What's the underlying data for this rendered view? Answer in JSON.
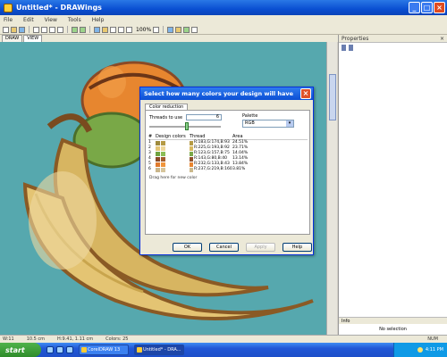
{
  "window": {
    "title": "Untitled* - DRAWings"
  },
  "menu": [
    "File",
    "Edit",
    "View",
    "Tools",
    "Help"
  ],
  "toolbar": {
    "zoom": "100%"
  },
  "tabs": [
    "DRAW",
    "VIEW"
  ],
  "properties": {
    "title": "Properties",
    "info_label": "Info",
    "info_value": "No selection"
  },
  "statusbar": {
    "w": "W:11",
    "h": "10.5 cm",
    "pos": "H:9.41, 1.11 cm",
    "colors": "Colors: 25",
    "right": "NUM"
  },
  "taskbar": {
    "start": "start",
    "tasks": [
      "CorelDRAW 13",
      "Untitled* - DRA..."
    ],
    "clock": "4:11 PM"
  },
  "dialog": {
    "title": "Select how many colors your design will have",
    "tab": "Color reduction",
    "threads_label": "Threads to use",
    "threads_value": "6",
    "palette_label": "Palette",
    "palette_value": "RGB",
    "columns": [
      "#",
      "Design colors",
      "Thread",
      "Area"
    ],
    "rows": [
      {
        "num": "1",
        "design": [
          "#9e8a3c",
          "#b59a44"
        ],
        "thread_color": "#b59a44",
        "thread": "R:183,G:174,B:93",
        "area": "24.51%"
      },
      {
        "num": "2",
        "design": [
          "#e3c473",
          "#efd79a"
        ],
        "thread_color": "#d9b85e",
        "thread": "R:225,G:193,B:92",
        "area": "23.71%"
      },
      {
        "num": "3",
        "design": [
          "#6fa23f",
          "#8bbd57"
        ],
        "thread_color": "#7aa849",
        "thread": "R:123,G:157,B:75",
        "area": "14.04%"
      },
      {
        "num": "4",
        "design": [
          "#8a4a26",
          "#a25c2f"
        ],
        "thread_color": "#8f4f2a",
        "thread": "R:143,G:80,B:40",
        "area": "13.14%"
      },
      {
        "num": "5",
        "design": [
          "#e07a2c",
          "#f0953c"
        ],
        "thread_color": "#e8852f",
        "thread": "R:232,G:133,B:43",
        "area": "13.84%"
      },
      {
        "num": "6",
        "design": [
          "#c9b58a",
          "#d6c59c"
        ],
        "thread_color": "#cbb98c",
        "thread": "R:237,G:219,B:160",
        "area": "3.81%"
      }
    ],
    "hint": "Drag here for new color",
    "buttons": {
      "ok": "OK",
      "cancel": "Cancel",
      "apply": "Apply",
      "help": "Help"
    }
  }
}
